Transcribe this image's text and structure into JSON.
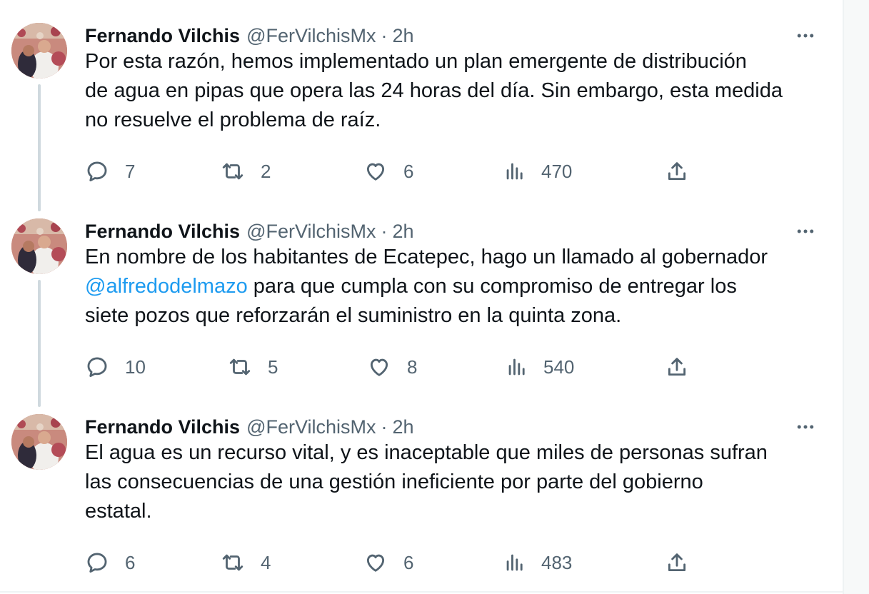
{
  "colors": {
    "text": "#0f1419",
    "secondary": "#536471",
    "link": "#1d9bf0",
    "thread_line": "#cfd9de",
    "divider": "#eff3f4"
  },
  "icons": {
    "more": "more-horizontal-icon",
    "reply": "reply-bubble-icon",
    "retweet": "retweet-arrows-icon",
    "like": "heart-outline-icon",
    "views": "views-bar-chart-icon",
    "share": "share-upload-icon"
  },
  "tweets": [
    {
      "author_name": "Fernando Vilchis",
      "author_handle": "@FerVilchisMx",
      "separator": "·",
      "time": "2h",
      "text_lines": [
        "Por esta razón, hemos implementado un plan emergente de distribución",
        "de agua en pipas que opera las 24 horas del día. Sin embargo, esta medida",
        "no resuelve el problema de raíz."
      ],
      "replies": "7",
      "retweets": "2",
      "likes": "6",
      "views": "470"
    },
    {
      "author_name": "Fernando Vilchis",
      "author_handle": "@FerVilchisMx",
      "separator": "·",
      "time": "2h",
      "text_line_1": "En nombre de los habitantes de Ecatepec, hago un llamado al gobernador",
      "mention": "@alfredodelmazo",
      "text_line_2_rest": " para que cumpla con su compromiso de entregar los",
      "text_line_3": "siete pozos que reforzarán el suministro en la quinta zona.",
      "replies": "10",
      "retweets": "5",
      "likes": "8",
      "views": "540"
    },
    {
      "author_name": "Fernando Vilchis",
      "author_handle": "@FerVilchisMx",
      "separator": "·",
      "time": "2h",
      "text_lines": [
        "El agua es un recurso vital, y es inaceptable que miles de personas sufran",
        "las consecuencias de una gestión ineficiente por parte del gobierno",
        "estatal."
      ],
      "replies": "6",
      "retweets": "4",
      "likes": "6",
      "views": "483"
    }
  ]
}
